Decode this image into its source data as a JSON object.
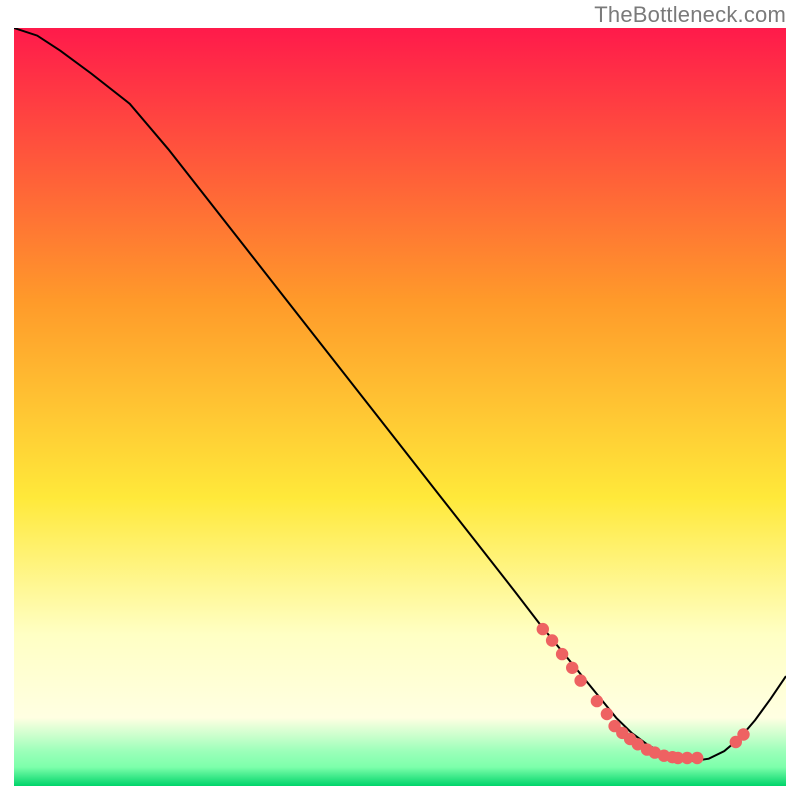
{
  "attribution": "TheBottleneck.com",
  "colors": {
    "gradient_top": "#ff1a4b",
    "gradient_mid_orange": "#ff9a2a",
    "gradient_yellow": "#ffe93a",
    "gradient_pale_yellow": "#ffffc4",
    "gradient_mint": "#9affb9",
    "gradient_green": "#00d46a",
    "line": "#000000",
    "marker": "#ee6262"
  },
  "chart_data": {
    "type": "line",
    "title": "",
    "xlabel": "",
    "ylabel": "",
    "xlim": [
      0,
      100
    ],
    "ylim": [
      0,
      100
    ],
    "x": [
      0,
      3,
      6,
      10,
      15,
      20,
      25,
      30,
      35,
      40,
      45,
      50,
      55,
      60,
      65,
      68,
      70,
      72,
      74,
      76,
      78,
      80,
      82,
      84,
      86,
      88,
      90,
      92,
      94,
      96,
      98,
      100
    ],
    "values": [
      100,
      99,
      97,
      94,
      90,
      84,
      77.5,
      71,
      64.5,
      58,
      51.5,
      45,
      38.5,
      32,
      25.5,
      21.5,
      19,
      16.5,
      14,
      11.5,
      9,
      7,
      5.5,
      4.3,
      3.6,
      3.3,
      3.6,
      4.6,
      6.3,
      8.7,
      11.5,
      14.5
    ],
    "markers": [
      {
        "x": 68.5,
        "y": 20.7
      },
      {
        "x": 69.7,
        "y": 19.2
      },
      {
        "x": 71.0,
        "y": 17.4
      },
      {
        "x": 72.3,
        "y": 15.6
      },
      {
        "x": 73.4,
        "y": 13.9
      },
      {
        "x": 75.5,
        "y": 11.2
      },
      {
        "x": 76.8,
        "y": 9.5
      },
      {
        "x": 77.8,
        "y": 7.9
      },
      {
        "x": 78.8,
        "y": 7.0
      },
      {
        "x": 79.8,
        "y": 6.2
      },
      {
        "x": 80.8,
        "y": 5.5
      },
      {
        "x": 82.0,
        "y": 4.8
      },
      {
        "x": 83.0,
        "y": 4.4
      },
      {
        "x": 84.2,
        "y": 4.0
      },
      {
        "x": 85.3,
        "y": 3.8
      },
      {
        "x": 86.0,
        "y": 3.7
      },
      {
        "x": 87.2,
        "y": 3.7
      },
      {
        "x": 88.5,
        "y": 3.7
      },
      {
        "x": 93.5,
        "y": 5.8
      },
      {
        "x": 94.5,
        "y": 6.8
      }
    ]
  }
}
